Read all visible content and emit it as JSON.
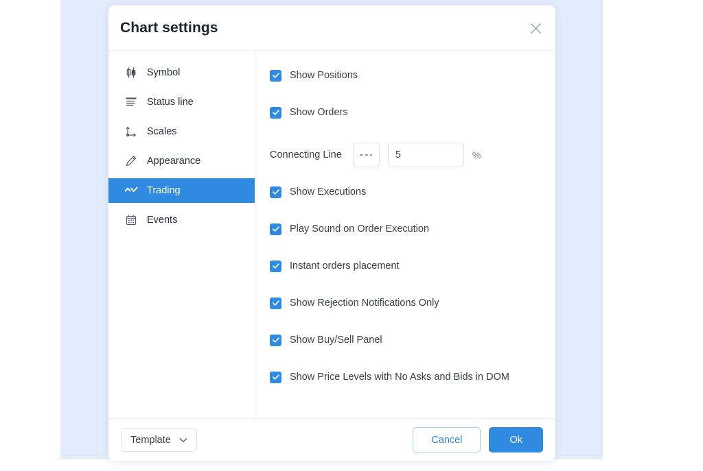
{
  "dialog": {
    "title": "Chart settings",
    "close_icon": "close-icon"
  },
  "sidebar": {
    "items": [
      {
        "label": "Symbol",
        "icon": "candlestick-icon",
        "selected": false
      },
      {
        "label": "Status line",
        "icon": "status-lines-icon",
        "selected": false
      },
      {
        "label": "Scales",
        "icon": "axes-icon",
        "selected": false
      },
      {
        "label": "Appearance",
        "icon": "pencil-icon",
        "selected": false
      },
      {
        "label": "Trading",
        "icon": "trend-zigzag-icon",
        "selected": true
      },
      {
        "label": "Events",
        "icon": "calendar-icon",
        "selected": false
      }
    ]
  },
  "content": {
    "checkboxes_top": [
      {
        "label": "Show Positions",
        "checked": true
      },
      {
        "label": "Show Orders",
        "checked": true
      }
    ],
    "connecting_line": {
      "label": "Connecting Line",
      "line_style": "dashed",
      "value": "5",
      "unit": "%"
    },
    "checkboxes_bottom": [
      {
        "label": "Show Executions",
        "checked": true
      },
      {
        "label": "Play Sound on Order Execution",
        "checked": true
      },
      {
        "label": "Instant orders placement",
        "checked": true
      },
      {
        "label": "Show Rejection Notifications Only",
        "checked": true
      },
      {
        "label": "Show Buy/Sell Panel",
        "checked": true
      },
      {
        "label": "Show Price Levels with No Asks and Bids in DOM",
        "checked": true
      }
    ]
  },
  "footer": {
    "template_label": "Template",
    "template_chevron": "chevron-down-icon",
    "cancel_label": "Cancel",
    "ok_label": "Ok"
  },
  "colors": {
    "accent": "#2f8ae0",
    "backdrop": "#e2ecfb",
    "text": "#3c4043",
    "border": "#e0e3eb"
  }
}
